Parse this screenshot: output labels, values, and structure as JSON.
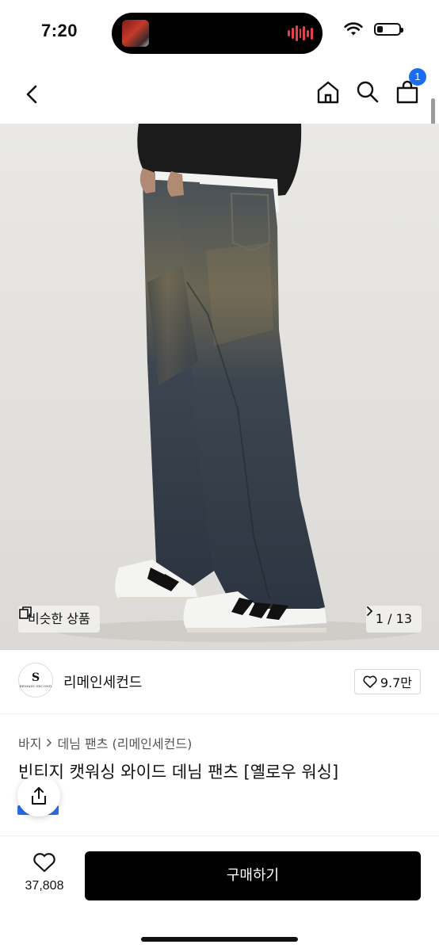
{
  "status": {
    "time": "7:20",
    "battery_level": 0.28
  },
  "nav": {
    "cart_count": "1"
  },
  "gallery": {
    "similar_label": "비슷한 상품",
    "page_indicator": "1 / 13"
  },
  "store": {
    "logo_initials": "S",
    "logo_text": "REMAIN SECOND",
    "name": "리메인세컨드",
    "likes": "9.7만"
  },
  "product": {
    "breadcrumb": [
      "바지",
      "데님 팬츠 (리메인세컨드)"
    ],
    "title": "빈티지 캣워싱 와이드 데님 팬츠 [옐로우 워싱]"
  },
  "bottom": {
    "wish_count": "37,808",
    "buy_label": "구매하기"
  },
  "colors": {
    "accent": "#1a6cf0",
    "buy_button": "#000000"
  }
}
